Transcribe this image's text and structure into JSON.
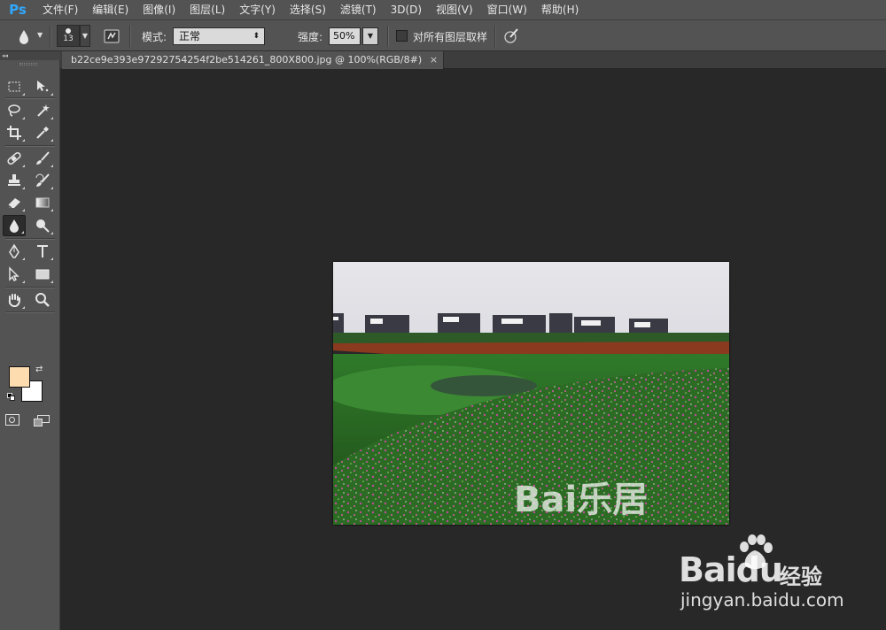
{
  "app": {
    "logo": "Ps"
  },
  "menu": [
    "文件(F)",
    "编辑(E)",
    "图像(I)",
    "图层(L)",
    "文字(Y)",
    "选择(S)",
    "滤镜(T)",
    "3D(D)",
    "视图(V)",
    "窗口(W)",
    "帮助(H)"
  ],
  "options": {
    "tool_icon": "blur-drop-icon",
    "brush_size": "13",
    "mode_label": "模式:",
    "mode_value": "正常",
    "strength_label": "强度:",
    "strength_value": "50%",
    "sample_all_layers_label": "对所有图层取样",
    "sample_all_layers_checked": false
  },
  "document": {
    "tab_title": "b22ce9e393e97292754254f2be514261_800X800.jpg @ 100%(RGB/8#)",
    "close_glyph": "×",
    "image_watermark": "Bai乐居"
  },
  "toolbar": {
    "collapse_glyph": "◂◂",
    "foreground_color": "#fddcb0",
    "background_color": "#ffffff",
    "active_tool": "blur"
  },
  "watermark": {
    "brand": "Baidu",
    "product": "经验",
    "url": "jingyan.baidu.com"
  }
}
